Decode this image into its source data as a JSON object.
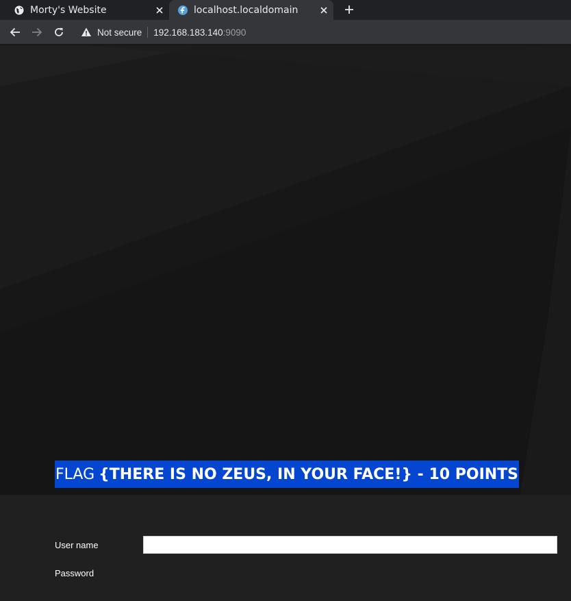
{
  "browser": {
    "tabs": [
      {
        "title": "Morty's Website",
        "icon": "globe-icon",
        "active": false
      },
      {
        "title": "localhost.localdomain",
        "icon": "fedora-icon",
        "active": true
      }
    ],
    "address_bar": {
      "security_label": "Not secure",
      "host": "192.168.183.140",
      "port": ":9090"
    }
  },
  "page": {
    "flag": {
      "lead": "FLAG",
      "rest": "{THERE IS NO ZEUS, IN YOUR FACE!} - 10 POINTS",
      "highlight_color": "#0546d1"
    },
    "login": {
      "username_label": "User name",
      "password_label": "Password",
      "username_value": ""
    }
  },
  "colors": {
    "tabstrip": "#202124",
    "toolbar": "#35363a",
    "page_bg": "#151515",
    "login_bg": "#202020"
  }
}
